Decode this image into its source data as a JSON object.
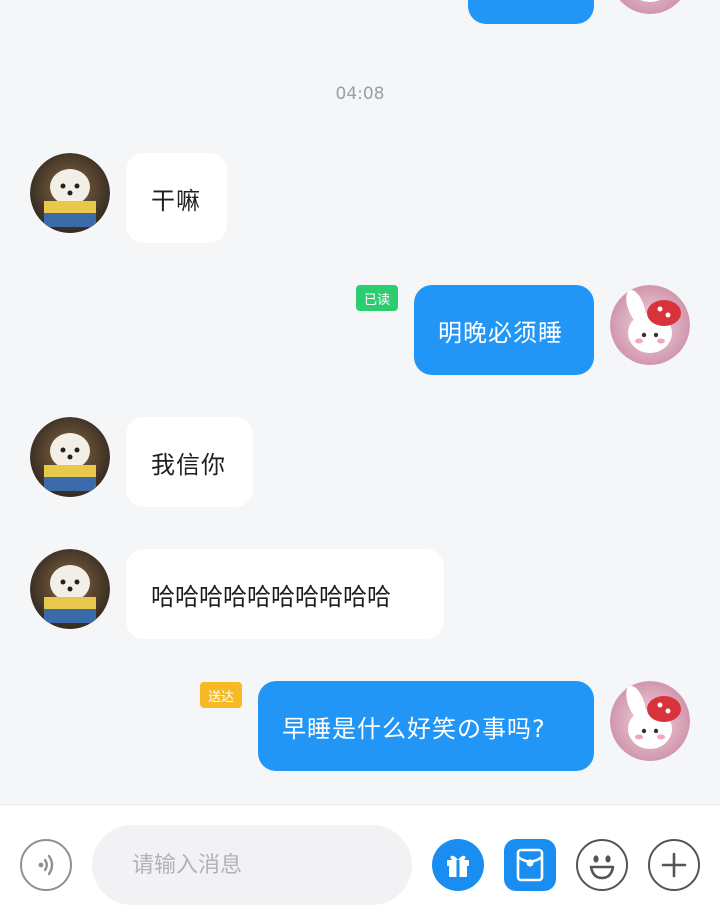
{
  "messages": {
    "time_label": "04:08",
    "m1": {
      "text": "干嘛"
    },
    "m2": {
      "text": "明晚必须睡",
      "status": "已读"
    },
    "m3": {
      "text": "我信你"
    },
    "m4": {
      "text": "哈哈哈哈哈哈哈哈哈哈"
    },
    "m5": {
      "text": "早睡是什么好笑の事吗?",
      "status": "送达"
    }
  },
  "input": {
    "placeholder": "请输入消息"
  },
  "toolbar": {
    "voice_icon": "voice-icon",
    "gift_icon": "gift-icon",
    "red_packet_icon": "red-packet-icon",
    "emoji_icon": "emoji-icon",
    "plus_icon": "plus-icon"
  },
  "colors": {
    "outgoing_bubble": "#2196f7",
    "incoming_bubble": "#ffffff",
    "read_badge": "#2ecc71",
    "delivered_badge": "#f7b924",
    "background": "#f5f6f8"
  }
}
